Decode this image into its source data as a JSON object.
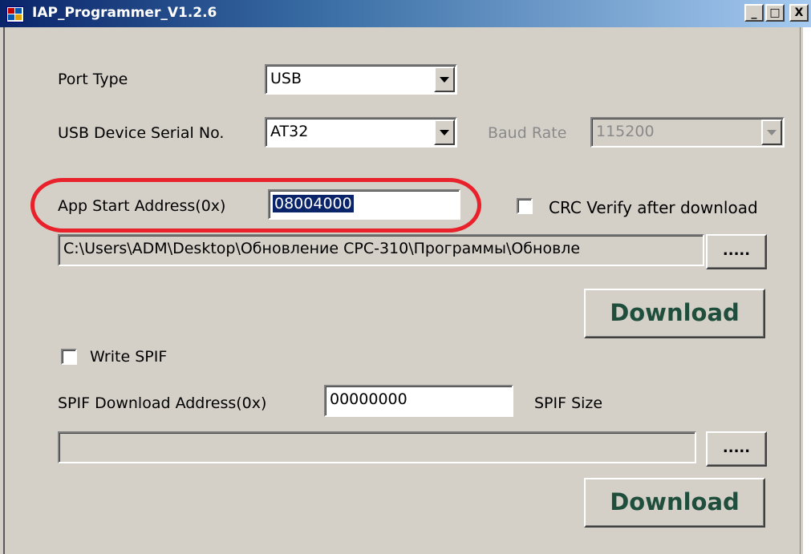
{
  "window": {
    "title": "IAP_Programmer_V1.2.6",
    "minimize_symbol": "_",
    "maximize_symbol": "□",
    "close_symbol": "X"
  },
  "port_type": {
    "label": "Port Type",
    "value": "USB"
  },
  "usb_serial": {
    "label": "USB Device Serial No.",
    "value": "AT32"
  },
  "baud_rate": {
    "label": "Baud Rate",
    "value": "115200",
    "enabled": false
  },
  "app_start": {
    "label": "App Start Address(0x)",
    "value": "08004000"
  },
  "crc_verify": {
    "label": "CRC Verify after download",
    "checked": false
  },
  "file_path": {
    "value": "C:\\Users\\ADM\\Desktop\\Обновление CPC-310\\Программы\\Обновле"
  },
  "browse_label": ".....",
  "download_label": "Download",
  "write_spif": {
    "label": "Write SPIF",
    "checked": false
  },
  "spif_address": {
    "label": "SPIF Download Address(0x)",
    "value": "00000000"
  },
  "spif_size": {
    "label": "SPIF Size"
  },
  "spif_path": {
    "value": ""
  },
  "colors": {
    "dialog_bg": "#d4d0c8",
    "annotation_red": "#e8212b",
    "download_text": "#1f4e3d",
    "selection_bg": "#0a246a"
  }
}
